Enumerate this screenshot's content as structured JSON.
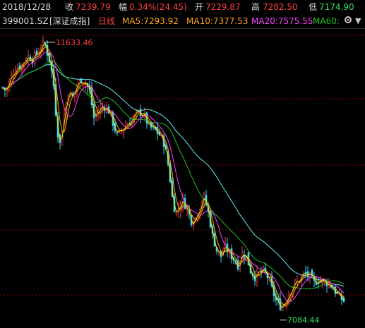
{
  "quote": {
    "date": "2018/12/28",
    "close_label": "收",
    "close": "7239.79",
    "change_label": "幅",
    "change": "0.34%(24.45)",
    "open_label": "开",
    "open": "7229.87",
    "high_label": "高",
    "high": "7282.50",
    "low_label": "低",
    "low": "7174.90"
  },
  "indicator": {
    "code": "399001.SZ",
    "name": "[深证成指]",
    "period": "日线",
    "ma5": "MA5:7293.92",
    "ma10": "MA10:7377.53",
    "ma20": "MA20:7575.55",
    "ma60": "MA60:",
    "settings_icon": "gear-icon",
    "collapse_icon": "triangle-down-icon"
  },
  "colors": {
    "up": "#ff4040",
    "down": "#38d8ff",
    "ma5": "#f0f000",
    "ma10": "#ffa020",
    "ma20": "#ff40ff",
    "ma60": "#20c020",
    "ma120": "#60f0f0",
    "text": "#d8d8d8",
    "grid": "#8a0000",
    "background": "#000000"
  },
  "chart_data": {
    "type": "candlestick",
    "title": "399001.SZ [深证成指] 日线",
    "y_max_label": "11633.46",
    "y_min_label": "7084.44",
    "ylim": [
      6900,
      11800
    ],
    "series": [
      {
        "name": "MA5",
        "last": 7293.92
      },
      {
        "name": "MA10",
        "last": 7377.53
      },
      {
        "name": "MA20",
        "last": 7575.55
      },
      {
        "name": "MA60",
        "last": null
      }
    ],
    "close_path": [
      [
        0,
        10900
      ],
      [
        8,
        10800
      ],
      [
        15,
        11050
      ],
      [
        22,
        11200
      ],
      [
        30,
        11250
      ],
      [
        38,
        11400
      ],
      [
        45,
        11350
      ],
      [
        52,
        11450
      ],
      [
        58,
        11550
      ],
      [
        62,
        11633
      ],
      [
        66,
        11450
      ],
      [
        70,
        11300
      ],
      [
        75,
        10900
      ],
      [
        80,
        10150
      ],
      [
        84,
        9900
      ],
      [
        90,
        10400
      ],
      [
        96,
        10800
      ],
      [
        102,
        10700
      ],
      [
        108,
        10900
      ],
      [
        114,
        11000
      ],
      [
        120,
        10950
      ],
      [
        126,
        10800
      ],
      [
        132,
        10350
      ],
      [
        138,
        10450
      ],
      [
        145,
        10550
      ],
      [
        152,
        10500
      ],
      [
        158,
        10300
      ],
      [
        165,
        10050
      ],
      [
        172,
        10150
      ],
      [
        180,
        10250
      ],
      [
        188,
        10350
      ],
      [
        196,
        10450
      ],
      [
        203,
        10400
      ],
      [
        210,
        10200
      ],
      [
        218,
        10150
      ],
      [
        226,
        10050
      ],
      [
        232,
        9900
      ],
      [
        238,
        9500
      ],
      [
        243,
        9000
      ],
      [
        248,
        8700
      ],
      [
        253,
        8850
      ],
      [
        258,
        8950
      ],
      [
        264,
        8800
      ],
      [
        270,
        8600
      ],
      [
        276,
        8650
      ],
      [
        282,
        8850
      ],
      [
        288,
        9000
      ],
      [
        294,
        8750
      ],
      [
        300,
        8350
      ],
      [
        306,
        8100
      ],
      [
        312,
        8000
      ],
      [
        318,
        8150
      ],
      [
        324,
        8050
      ],
      [
        330,
        7950
      ],
      [
        336,
        7850
      ],
      [
        342,
        8050
      ],
      [
        348,
        8000
      ],
      [
        354,
        7750
      ],
      [
        360,
        7650
      ],
      [
        366,
        7700
      ],
      [
        372,
        7750
      ],
      [
        378,
        7650
      ],
      [
        384,
        7450
      ],
      [
        390,
        7250
      ],
      [
        396,
        7150
      ],
      [
        402,
        7200
      ],
      [
        408,
        7350
      ],
      [
        414,
        7500
      ],
      [
        420,
        7550
      ],
      [
        426,
        7650
      ],
      [
        432,
        7700
      ],
      [
        438,
        7650
      ],
      [
        444,
        7550
      ],
      [
        450,
        7600
      ],
      [
        456,
        7580
      ],
      [
        462,
        7550
      ],
      [
        468,
        7500
      ],
      [
        474,
        7400
      ],
      [
        480,
        7300
      ],
      [
        486,
        7240
      ]
    ]
  }
}
